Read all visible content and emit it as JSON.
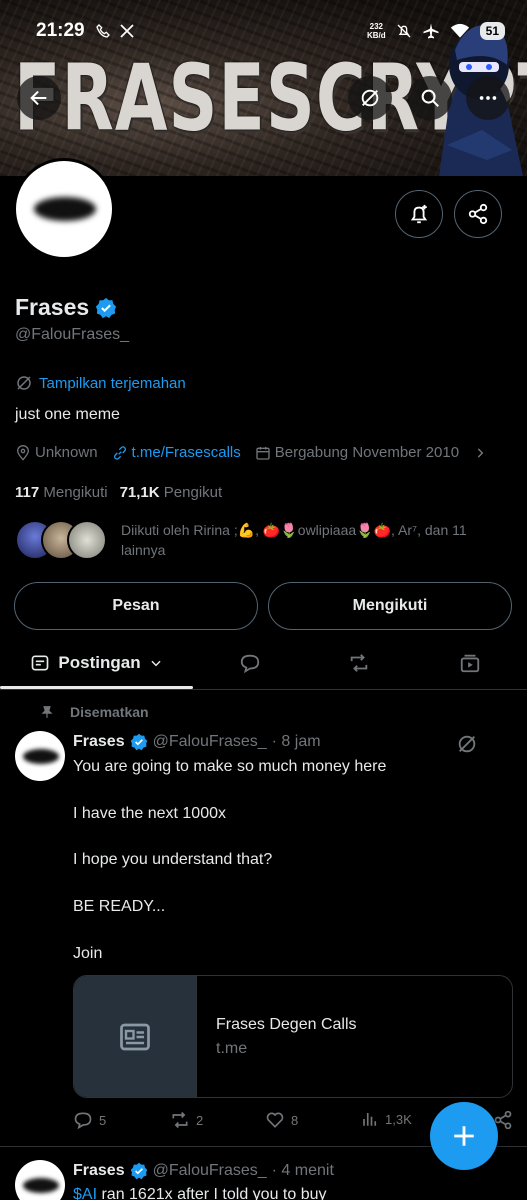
{
  "status_bar": {
    "time": "21:29",
    "net_speed_value": "232",
    "net_speed_unit": "KB/d",
    "battery": "51"
  },
  "banner": {
    "title": "FRASESCRYPT"
  },
  "profile": {
    "name": "Frases",
    "handle": "@FalouFrases_",
    "translate_label": "Tampilkan terjemahan",
    "bio": "just one meme",
    "location": "Unknown",
    "link": "t.me/Frasescalls",
    "joined": "Bergabung November 2010",
    "following_count": "117",
    "following_label": "Mengikuti",
    "followers_count": "71,1K",
    "followers_label": "Pengikut",
    "followed_by": "Diikuti oleh Ririna ;💪, 🍅🌷owlipiaaa🌷🍅, Ar⁷, dan 11 lainnya"
  },
  "buttons": {
    "message": "Pesan",
    "following": "Mengikuti"
  },
  "tabs": {
    "posts": "Postingan"
  },
  "pinned_post": {
    "pinned_label": "Disematkan",
    "author": "Frases",
    "handle": "@FalouFrases_",
    "time": "· 8 jam",
    "lines": [
      "You are going to make so much money here",
      "I have the next 1000x",
      "I hope you understand that?",
      "BE READY...",
      "Join"
    ],
    "card_title": "Frases Degen Calls",
    "card_domain": "t.me",
    "replies": "5",
    "reposts": "2",
    "likes": "8",
    "views": "1,3K"
  },
  "next_post": {
    "author": "Frases",
    "handle": "@FalouFrases_",
    "time": "· 4 menit",
    "cashtag": "$AI",
    "text_rest": " ran 1621x after I told you to buy"
  },
  "colors": {
    "accent": "#1d9bf0",
    "background": "#000000",
    "text_secondary": "#71767b"
  }
}
